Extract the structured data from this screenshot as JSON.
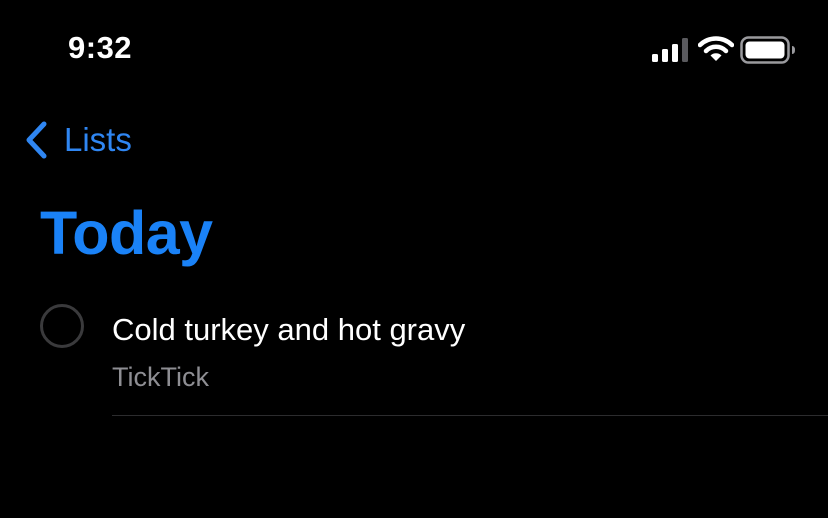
{
  "status_bar": {
    "time": "9:32",
    "icons": [
      "cellular-signal-icon",
      "wifi-icon",
      "battery-icon"
    ]
  },
  "nav": {
    "back_label": "Lists",
    "back_icon": "chevron-left-icon"
  },
  "title": "Today",
  "tasks": [
    {
      "title": "Cold turkey and hot gravy",
      "list": "TickTick",
      "completed": false
    }
  ],
  "colors": {
    "background": "#000000",
    "accent": "#1a82f7",
    "primary_text": "#ffffff",
    "secondary_text": "#8e8e93",
    "separator": "#2c2c2e"
  }
}
